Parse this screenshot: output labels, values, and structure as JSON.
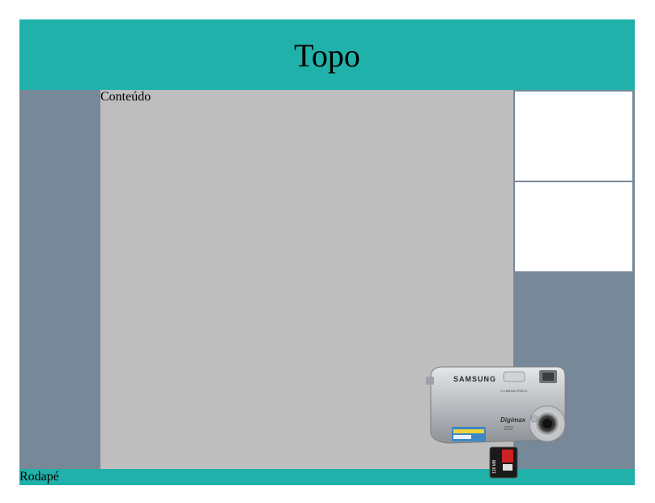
{
  "header": {
    "title": "Topo"
  },
  "content": {
    "label": "Conteúdo"
  },
  "footer": {
    "label": "Rodapé"
  },
  "images": {
    "camera": {
      "brand": "SAMSUNG",
      "model": "Digimax",
      "model_number": "202"
    },
    "memory_card": {
      "text": "128 MB"
    }
  },
  "colors": {
    "header_bg": "#20b2aa",
    "footer_bg": "#20b2aa",
    "side_bg": "#778899",
    "content_bg": "#bebebe",
    "box_bg": "#ffffff"
  }
}
